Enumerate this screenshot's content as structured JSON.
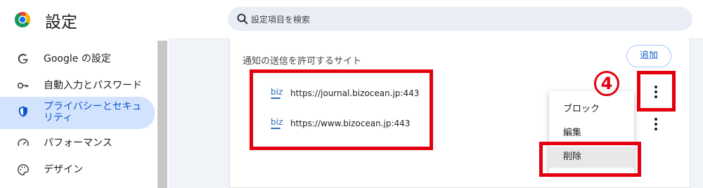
{
  "header": {
    "title": "設定",
    "search_placeholder": "設定項目を検索"
  },
  "sidebar": {
    "items": [
      {
        "label": "Google の設定",
        "icon": "google-icon"
      },
      {
        "label": "自動入力とパスワード",
        "icon": "key-icon"
      },
      {
        "label": "プライバシーとセキュリティ",
        "icon": "shield-icon",
        "active": true
      },
      {
        "label": "パフォーマンス",
        "icon": "speedometer-icon"
      },
      {
        "label": "デザイン",
        "icon": "palette-icon"
      }
    ]
  },
  "main": {
    "section_title": "通知の送信を許可するサイト",
    "add_label": "追加",
    "sites": [
      {
        "favicon_text": "biz",
        "url": "https://journal.bizocean.jp:443"
      },
      {
        "favicon_text": "biz",
        "url": "https://www.bizocean.jp:443"
      }
    ]
  },
  "menu": {
    "items": [
      "ブロック",
      "編集",
      "削除"
    ],
    "highlighted": "削除"
  },
  "annotation": {
    "step_number": "4"
  },
  "colors": {
    "accent": "#0b57d0",
    "active_bg": "#d3e3fd",
    "annotation_red": "#e3000f",
    "search_bg": "#e9eef6",
    "panel_bg": "#f0f4f9"
  }
}
